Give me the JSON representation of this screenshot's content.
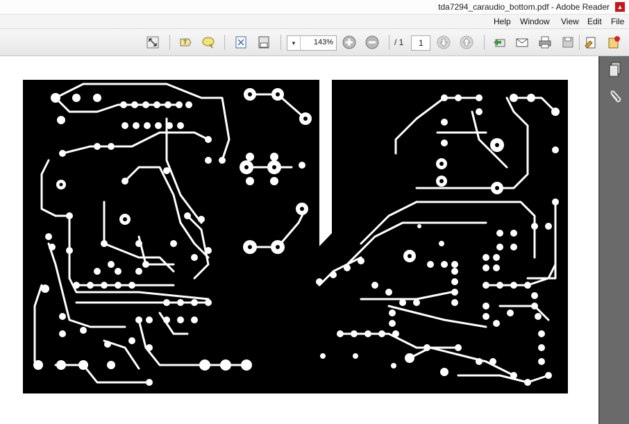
{
  "window": {
    "title": "tda7294_caraudio_bottom.pdf - Adobe Reader"
  },
  "menu": {
    "items": [
      "File",
      "Edit",
      "View",
      "Window",
      "Help"
    ]
  },
  "toolbar": {
    "page_current": "1",
    "page_total": "/ 1",
    "zoom": "143%"
  },
  "icons": {
    "app": "adobe-pdf-icon",
    "create": "create-pdf-icon",
    "sign": "sign-icon",
    "save": "save-icon",
    "print": "print-icon",
    "email": "email-icon",
    "share": "share-icon",
    "scroll_up": "previous-page-icon",
    "scroll_down": "next-page-icon",
    "zoom_out": "zoom-out-icon",
    "zoom_in": "zoom-in-icon",
    "save_copy": "save-copy-icon",
    "fit_page": "fit-page-icon",
    "comment": "comment-icon",
    "highlight": "highlight-icon",
    "fullscreen": "fullscreen-icon",
    "pages_panel": "pages-panel-icon",
    "attachments_panel": "attachments-icon"
  },
  "colors": {
    "pcb": "#000000",
    "copper": "#ffffff",
    "side_panel": "#6a6a6a"
  }
}
